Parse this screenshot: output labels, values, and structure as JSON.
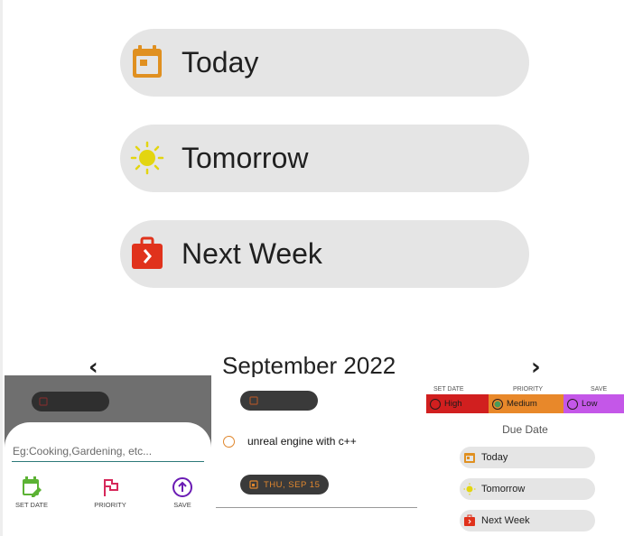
{
  "due_options": [
    {
      "label": "Today",
      "icon": "calendar-today-icon"
    },
    {
      "label": "Tomorrow",
      "icon": "sun-icon"
    },
    {
      "label": "Next Week",
      "icon": "briefcase-icon"
    }
  ],
  "calendar": {
    "month_label": "September 2022",
    "prev_icon": "chevron-left-icon",
    "next_icon": "chevron-right-icon"
  },
  "add_task_sheet": {
    "input_placeholder": "Eg:Cooking,Gardening, etc...",
    "input_value": "",
    "actions": [
      {
        "label": "SET DATE",
        "icon": "calendar-edit-icon",
        "color": "#5cb234"
      },
      {
        "label": "PRIORITY",
        "icon": "flag-icon",
        "color": "#d6285a"
      },
      {
        "label": "SAVE",
        "icon": "arrow-up-circle-icon",
        "color": "#6a1bb4"
      }
    ]
  },
  "task_list": {
    "header_date": "THU, SEP 15",
    "tasks": [
      {
        "title": "unreal engine with c++",
        "date": "THU, SEP 15"
      }
    ]
  },
  "priority_panel": {
    "top_labels": [
      "SET DATE",
      "PRIORITY",
      "SAVE"
    ],
    "priorities": [
      {
        "label": "High",
        "color": "#d11f1f",
        "selected": false
      },
      {
        "label": "Medium",
        "color": "#e8882a",
        "selected": true
      },
      {
        "label": "Low",
        "color": "#c457e8",
        "selected": false
      }
    ],
    "due_date_title": "Due Date",
    "due_options": [
      {
        "label": "Today",
        "icon": "calendar-today-icon"
      },
      {
        "label": "Tomorrow",
        "icon": "sun-icon"
      },
      {
        "label": "Next Week",
        "icon": "briefcase-icon"
      }
    ]
  },
  "colors": {
    "pill_background": "#e5e5e5",
    "accent_orange": "#e0872e",
    "calendar_orange": "#e09020",
    "sun_yellow": "#e3d511",
    "briefcase_red": "#e0321c"
  }
}
